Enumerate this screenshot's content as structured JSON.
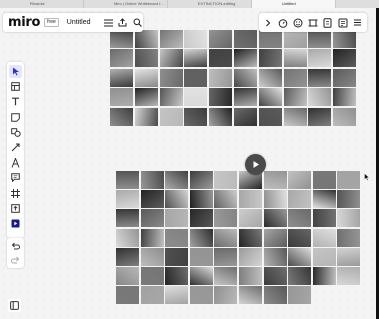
{
  "browser": {
    "tabs": [
      {
        "title": "Rivarole",
        "active": false
      },
      {
        "title": "Miro | Online Whiteboard f...",
        "active": false
      },
      {
        "title": "EXTINCTION-editing",
        "active": false
      },
      {
        "title": "Untitled",
        "active": true
      }
    ]
  },
  "board": {
    "logo": "miro",
    "plan": "free",
    "name": "Untitled",
    "menu_icon": "menu-icon",
    "share_icon": "share-icon",
    "search_icon": "search-icon"
  },
  "top_right_toolbar": {
    "icons": [
      "chevron-right-icon",
      "timer-icon",
      "reactions-icon",
      "frame-icon",
      "card-icon",
      "notes-icon",
      "more-icon"
    ]
  },
  "left_toolbar": {
    "tools": [
      "select-icon",
      "template-icon",
      "text-icon",
      "sticky-note-icon",
      "shapes-icon",
      "line-icon",
      "pen-icon",
      "comment-icon",
      "frame-icon",
      "upload-icon",
      "apps-icon"
    ],
    "active_tool": "select-icon",
    "undo_icon": "undo-icon",
    "redo_icon": "redo-icon",
    "panel_icon": "panel-icon"
  },
  "photo_grids": {
    "top": {
      "rows": 5,
      "cols": 10,
      "photos": 50
    },
    "bottom": {
      "rows": 7,
      "cols": 10,
      "photos": 68
    }
  },
  "colors": {
    "canvas": "#f4f4f4",
    "toolbar_bg": "#ffffff",
    "active_tool": "#e3e6ff",
    "play_button": "#4a4a4a"
  }
}
